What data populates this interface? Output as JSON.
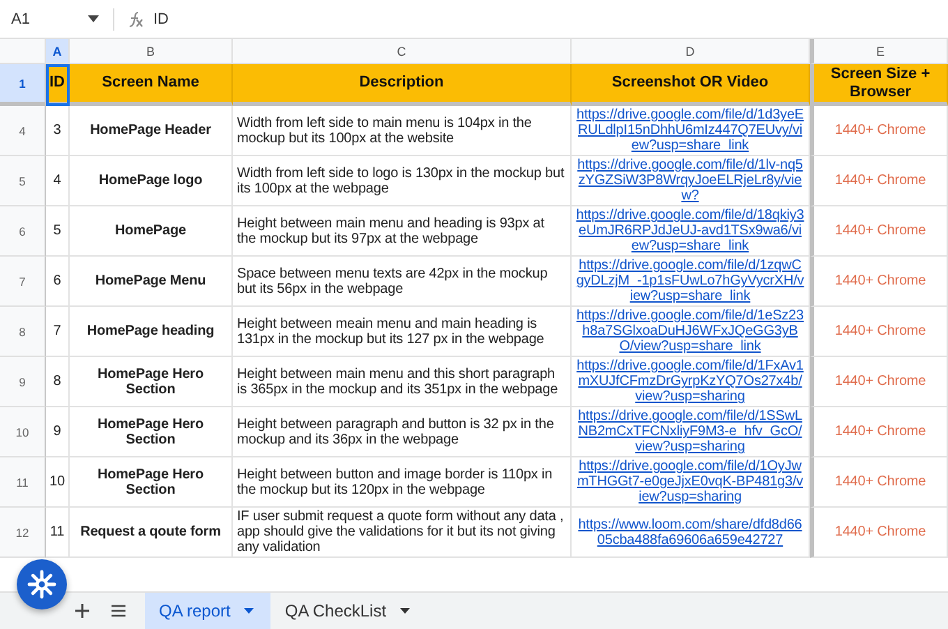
{
  "formula_bar": {
    "cell_ref": "A1",
    "formula": "ID"
  },
  "columns": [
    {
      "label": "A",
      "selected": true
    },
    {
      "label": "B",
      "selected": false
    },
    {
      "label": "C",
      "selected": false
    },
    {
      "label": "D",
      "selected": false
    },
    {
      "label": "E",
      "selected": false
    }
  ],
  "header_row": {
    "number": "1",
    "selected": true,
    "cells": [
      "ID",
      "Screen Name",
      "Description",
      "Screenshot OR Video",
      "Screen Size + Browser"
    ]
  },
  "rows": [
    {
      "number": "4",
      "selected": false,
      "id": "3",
      "screen_name": "HomePage Header",
      "description": "Width from left side to main menu is 104px in the mockup but its 100px at the website",
      "link": "https://drive.google.com/file/d/1d3yeERULdlpI15nDhhU6mIz447Q7EUvy/view?usp=share_link",
      "screen_size": "1440+ Chrome"
    },
    {
      "number": "5",
      "selected": false,
      "id": "4",
      "screen_name": "HomePage logo",
      "description": "Width from left side to logo is 130px in the mockup but its 100px at the webpage",
      "link": "https://drive.google.com/file/d/1lv-nq5zYGZSiW3P8WrqyJoeELRjeLr8y/view?",
      "screen_size": "1440+ Chrome"
    },
    {
      "number": "6",
      "selected": false,
      "id": "5",
      "screen_name": "HomePage",
      "description": "Height between main menu and heading is 93px at the mockup but its 97px at the webpage",
      "link": "https://drive.google.com/file/d/18qkiy3eUmJR6RPJdJeUJ-avd1TSx9wa6/view?usp=share_link",
      "screen_size": "1440+ Chrome"
    },
    {
      "number": "7",
      "selected": false,
      "id": "6",
      "screen_name": "HomePage Menu",
      "description": "Space between menu texts are 42px in the mockup but its 56px in the webpage",
      "link": "https://drive.google.com/file/d/1zqwCgyDLzjM_-1p1sFUwLo7hGyVycrXH/view?usp=share_link",
      "screen_size": "1440+ Chrome"
    },
    {
      "number": "8",
      "selected": false,
      "id": "7",
      "screen_name": "HomePage heading",
      "description": "Height between meain menu and main heading is 131px in the mockup but its 127 px in the webpage",
      "link": "https://drive.google.com/file/d/1eSz23h8a7SGlxoaDuHJ6WFxJQeGG3yBO/view?usp=share_link",
      "screen_size": "1440+ Chrome"
    },
    {
      "number": "9",
      "selected": false,
      "id": "8",
      "screen_name": "HomePage Hero Section",
      "description": "Height between main menu and this short paragraph is 365px in the mockup and its 351px in the webpage",
      "link": "https://drive.google.com/file/d/1FxAv1mXUJfCFmzDrGyrpKzYQ7Os27x4b/view?usp=sharing",
      "screen_size": "1440+ Chrome"
    },
    {
      "number": "10",
      "selected": false,
      "id": "9",
      "screen_name": "HomePage Hero Section",
      "description": "Height between paragraph and button is 32 px in the mockup and its 36px in the webpage",
      "link": "https://drive.google.com/file/d/1SSwLNB2mCxTFCNxliyF9M3-e_hfv_GcO/view?usp=sharing",
      "screen_size": "1440+ Chrome"
    },
    {
      "number": "11",
      "selected": false,
      "id": "10",
      "screen_name": "HomePage Hero Section",
      "description": "Height between button and image border is 110px in the mockup but its 120px in the webpage",
      "link": "https://drive.google.com/file/d/1OyJwmTHGGt7-e0geJjxE0vqK-BP481g3/view?usp=sharing",
      "screen_size": "1440+ Chrome"
    },
    {
      "number": "12",
      "selected": false,
      "id": "11",
      "screen_name": "Request a qoute form",
      "description": "IF user submit request a quote form without any data , app should give the validations for it but its not giving any validation",
      "link": "https://www.loom.com/share/dfd8d6605cba488fa69606a659e42727",
      "screen_size": "1440+ Chrome"
    }
  ],
  "sheet_tabs": [
    {
      "label": "QA report",
      "selected": true
    },
    {
      "label": "QA CheckList",
      "selected": false
    }
  ]
}
